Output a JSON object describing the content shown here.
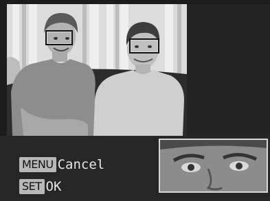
{
  "preview": {
    "detected_faces": 2,
    "selected_face": 2
  },
  "controls": {
    "menu_key": "MENU",
    "menu_action": "Cancel",
    "set_key": "SET",
    "set_action": "OK"
  },
  "colors": {
    "frame_outline": "#d8d8d8",
    "key_chip_bg": "#b8b8b8",
    "text": "#e6e6e6"
  }
}
